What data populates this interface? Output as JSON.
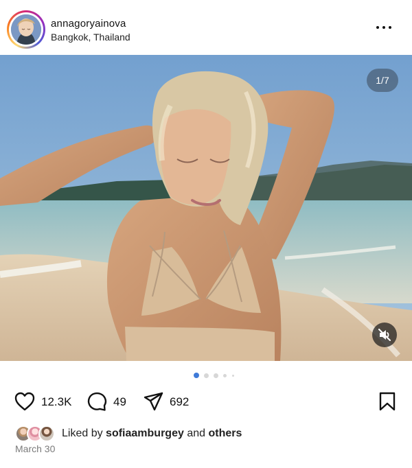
{
  "post": {
    "header": {
      "username": "annagoryainova",
      "location": "Bangkok, Thailand"
    },
    "media": {
      "counter": "1/7"
    },
    "actions": {
      "likes": "12.3K",
      "comments": "49",
      "shares": "692"
    },
    "likes_line": {
      "prefix": "Liked by",
      "user": "sofiaamburgey",
      "middle": "and",
      "suffix": "others"
    },
    "date": "March 30"
  },
  "icons": {
    "more": "more-options-icon",
    "mute": "mute-icon",
    "like": "heart-icon",
    "comment": "comment-icon",
    "share": "share-icon",
    "save": "bookmark-icon"
  },
  "colors": {
    "text": "#111111",
    "muted": "#7a7a7a",
    "dot_active": "#3f7ad8",
    "dot_inactive": "#d7d7d7"
  }
}
